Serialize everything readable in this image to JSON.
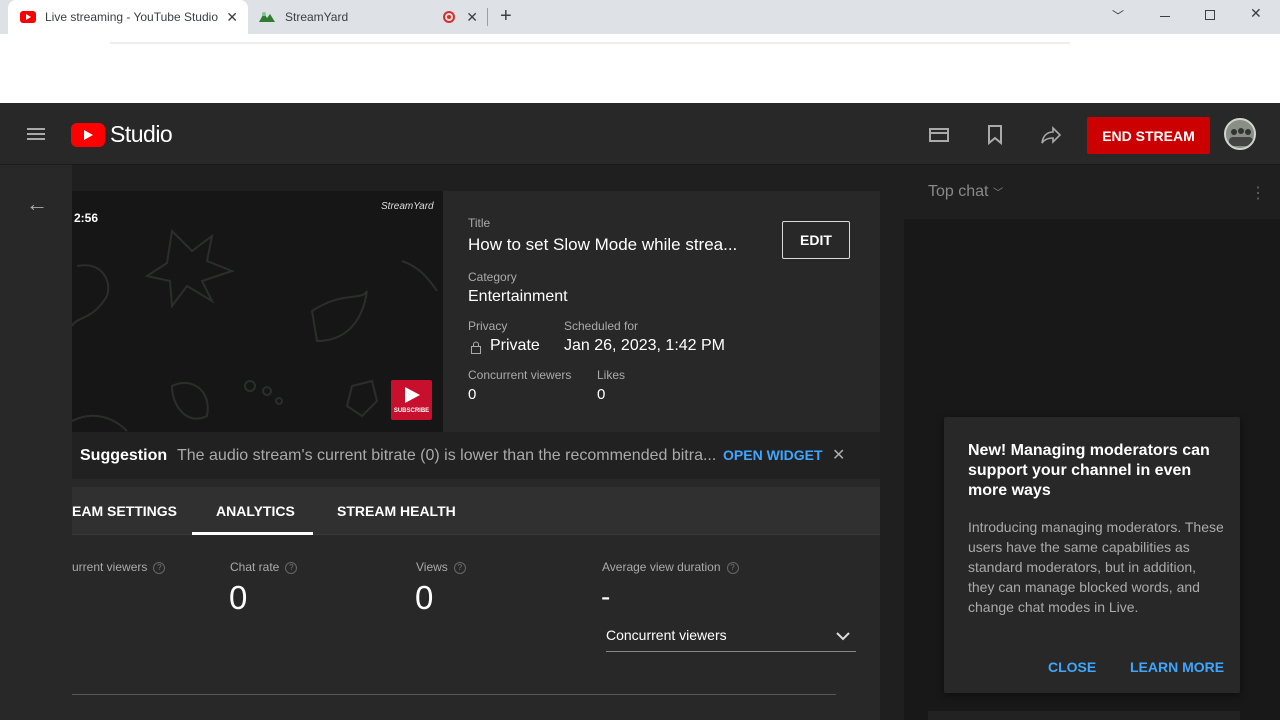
{
  "browser": {
    "tabs": [
      {
        "title": "Live streaming - YouTube Studio"
      },
      {
        "title": "StreamYard"
      }
    ]
  },
  "header": {
    "logo_text": "Studio",
    "end_stream_label": "END STREAM"
  },
  "preview": {
    "timer": "2:56",
    "watermark": "StreamYard",
    "subscribe_label": "SUBSCRIBE"
  },
  "details": {
    "title_label": "Title",
    "title_value": "How to set Slow Mode while strea...",
    "edit_label": "EDIT",
    "category_label": "Category",
    "category_value": "Entertainment",
    "privacy_label": "Privacy",
    "privacy_value": "Private",
    "scheduled_label": "Scheduled for",
    "scheduled_value": "Jan 26, 2023, 1:42 PM",
    "concurrent_label": "Concurrent viewers",
    "concurrent_value": "0",
    "likes_label": "Likes",
    "likes_value": "0"
  },
  "suggestion": {
    "label": "Suggestion",
    "text": "The audio stream's current bitrate (0) is lower than the recommended bitra...",
    "open_widget_label": "OPEN WIDGET"
  },
  "tabs": [
    "EAM SETTINGS",
    "ANALYTICS",
    "STREAM HEALTH"
  ],
  "metrics": [
    {
      "label": "urrent viewers",
      "value": ""
    },
    {
      "label": "Chat rate",
      "value": "0"
    },
    {
      "label": "Views",
      "value": "0"
    },
    {
      "label": "Average view duration",
      "value": "-"
    }
  ],
  "dropdown": {
    "selected": "Concurrent viewers"
  },
  "chat": {
    "mode_label": "Top chat"
  },
  "popup": {
    "title": "New! Managing moderators can support your channel in even more ways",
    "body": "Introducing managing moderators. These users have the same capabilities as standard moderators, but in addition, they can manage blocked words, and change chat modes in Live.",
    "close_label": "CLOSE",
    "learn_more_label": "LEARN MORE"
  },
  "colors": {
    "youtube_red": "#ff0000",
    "end_stream_bg": "#cc0000",
    "link_blue": "#3ea6ff"
  }
}
